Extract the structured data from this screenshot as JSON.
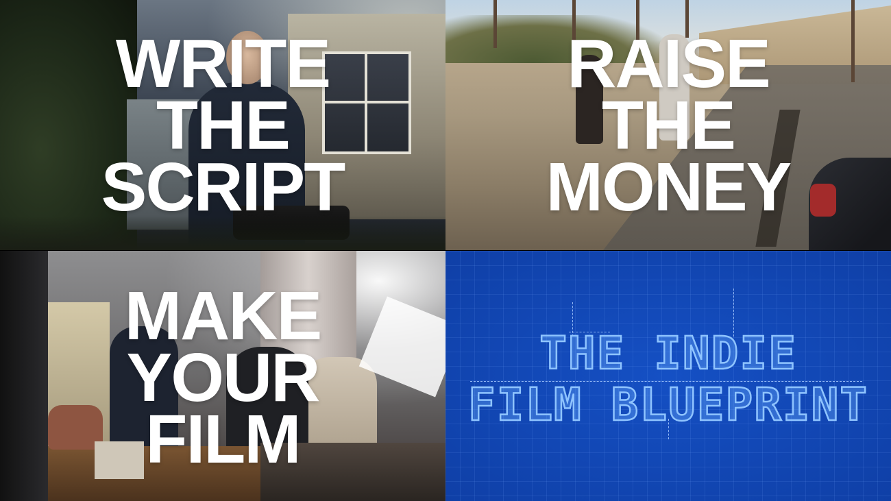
{
  "panels": [
    {
      "id": "write-the-script",
      "lines": [
        "WRITE",
        "THE",
        "SCRIPT"
      ]
    },
    {
      "id": "raise-the-money",
      "lines": [
        "RAISE",
        "THE",
        "MONEY"
      ]
    },
    {
      "id": "make-your-film",
      "lines": [
        "MAKE",
        "YOUR",
        "FILM"
      ]
    }
  ],
  "blueprint": {
    "title_line1": "THE INDIE",
    "title_line2": "FILM BLUEPRINT",
    "background_color": "#1148b4",
    "text_color": "#8fc4ff"
  }
}
